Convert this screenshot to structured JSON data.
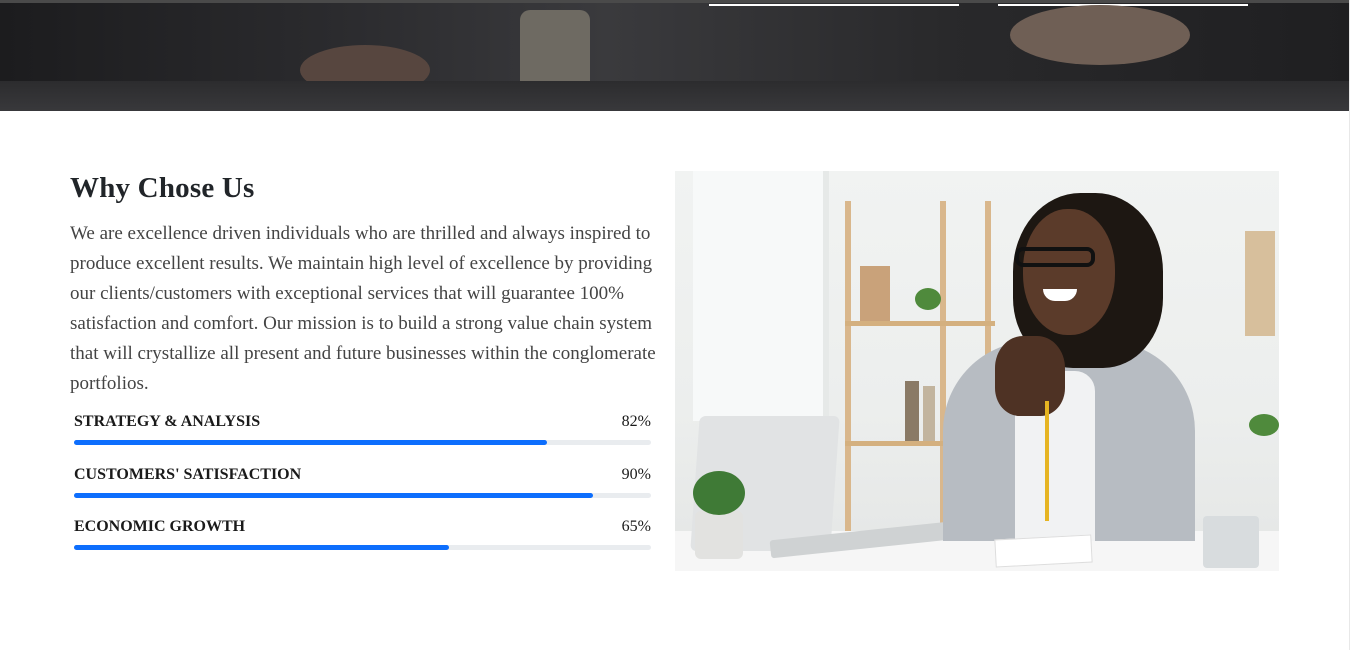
{
  "why_us": {
    "title": "Why Chose Us",
    "description": "We are excellence driven individuals who are thrilled and always inspired to produce excellent results. We maintain high level of excellence by providing our clients/customers with exceptional services that will guarantee 100% satisfaction and comfort. Our mission is to build a strong value chain system that will crystallize all present and future businesses within the conglomerate portfolios."
  },
  "skills": [
    {
      "label": "Strategy & Analysis",
      "percent_text": "82%",
      "value": 82
    },
    {
      "label": "Customers' Satisfaction",
      "percent_text": "90%",
      "value": 90
    },
    {
      "label": "Economic Growth",
      "percent_text": "65%",
      "value": 65
    }
  ],
  "colors": {
    "progress_fill": "#0d6efd",
    "progress_track": "#e9ecef",
    "heading": "#212529"
  },
  "images": {
    "banner": "office-desk-photo",
    "feature": "smiling-woman-at-laptop-photo"
  }
}
